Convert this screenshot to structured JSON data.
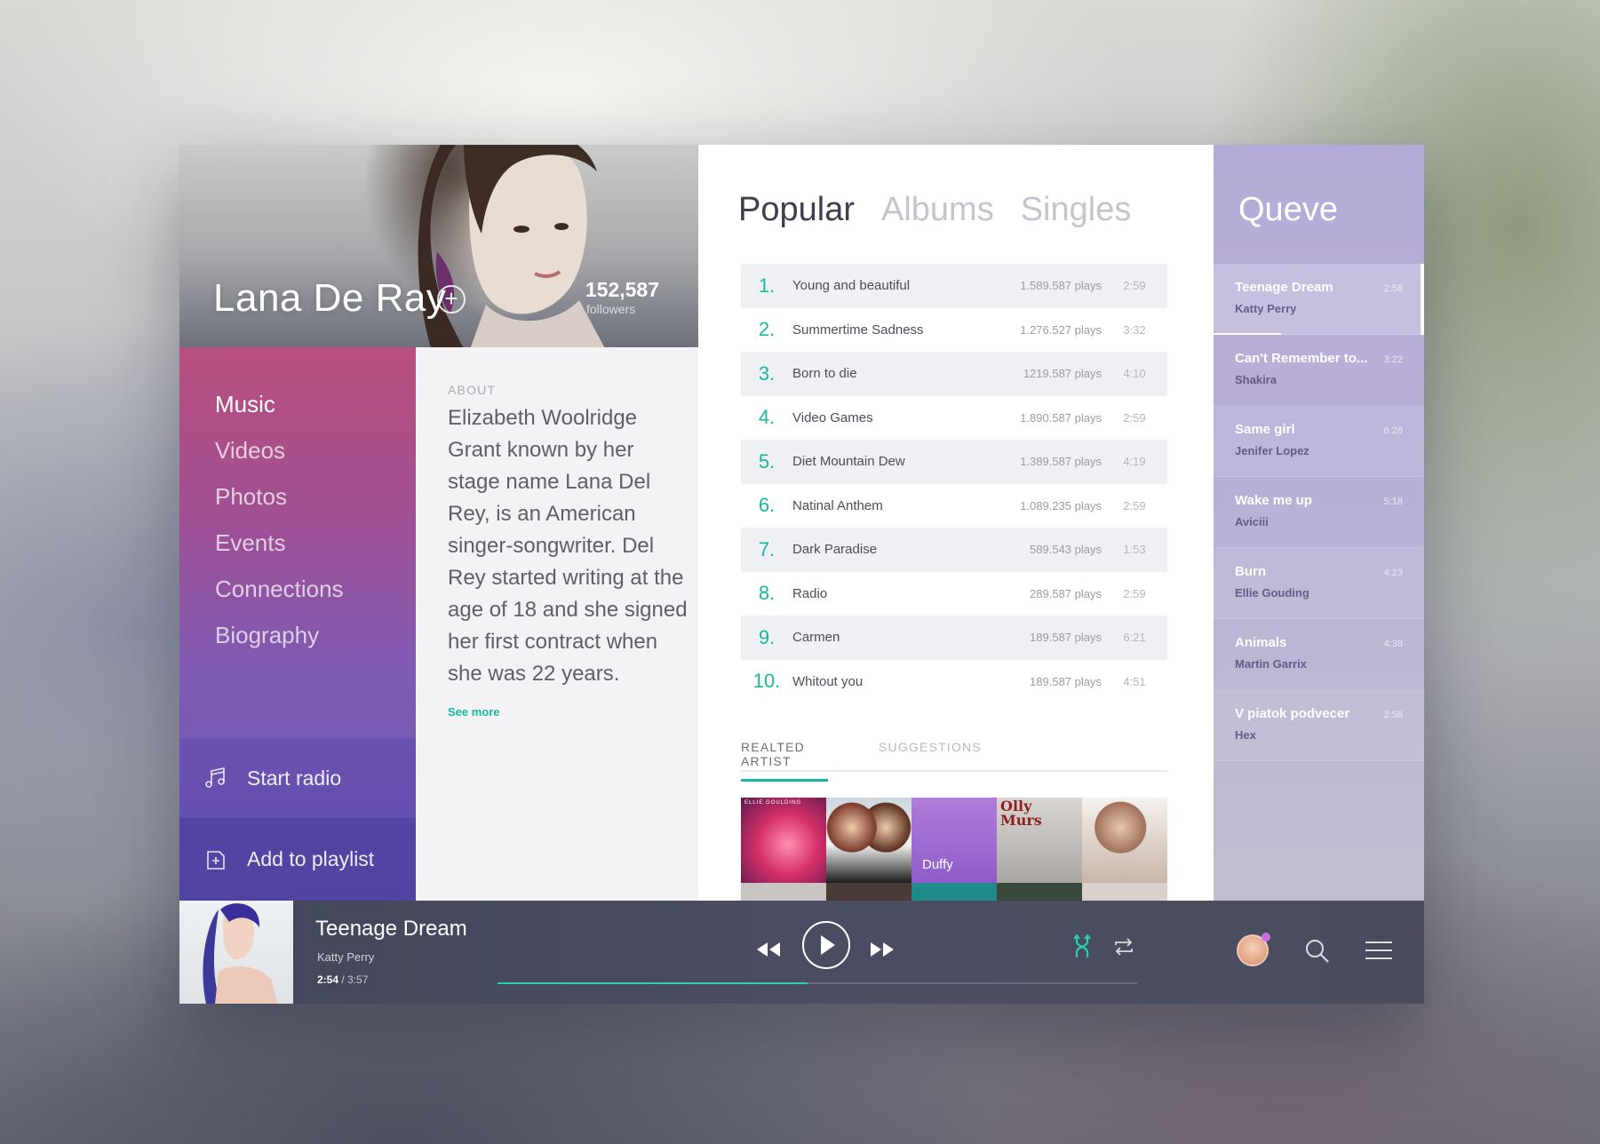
{
  "artist": {
    "name": "Lana De Ray",
    "followers_count": "152,587",
    "followers_label": "followers"
  },
  "nav": {
    "items": [
      {
        "label": "Music",
        "active": true
      },
      {
        "label": "Videos",
        "active": false
      },
      {
        "label": "Photos",
        "active": false
      },
      {
        "label": "Events",
        "active": false
      },
      {
        "label": "Connections",
        "active": false
      },
      {
        "label": "Biography",
        "active": false
      }
    ],
    "start_radio": "Start radio",
    "add_to_playlist": "Add to playlist"
  },
  "about": {
    "heading": "ABOUT",
    "text": "Elizabeth Woolridge Grant known by her stage name Lana Del Rey, is an American singer-songwriter. Del Rey started writing at the age of 18 and she signed her first contract when she was 22 years.",
    "see_more": "See more"
  },
  "tabs": [
    {
      "label": "Popular",
      "active": true
    },
    {
      "label": "Albums",
      "active": false
    },
    {
      "label": "Singles",
      "active": false
    }
  ],
  "tracks": [
    {
      "num": "1.",
      "title": "Young and beautiful",
      "plays": "1.589.587 plays",
      "duration": "2:59"
    },
    {
      "num": "2.",
      "title": "Summertime Sadness",
      "plays": "1.276.527 plays",
      "duration": "3:32"
    },
    {
      "num": "3.",
      "title": "Born to die",
      "plays": "1219.587 plays",
      "duration": "4:10"
    },
    {
      "num": "4.",
      "title": "Video Games",
      "plays": "1.890.587 plays",
      "duration": "2:59"
    },
    {
      "num": "5.",
      "title": "Diet Mountain Dew",
      "plays": "1.389.587 plays",
      "duration": "4:19"
    },
    {
      "num": "6.",
      "title": "Natinal Anthem",
      "plays": "1.089.235 plays",
      "duration": "2:59"
    },
    {
      "num": "7.",
      "title": "Dark Paradise",
      "plays": "589.543 plays",
      "duration": "1:53"
    },
    {
      "num": "8.",
      "title": "Radio",
      "plays": "289.587 plays",
      "duration": "2:59"
    },
    {
      "num": "9.",
      "title": "Carmen",
      "plays": "189.587 plays",
      "duration": "6:21"
    },
    {
      "num": "10.",
      "title": "Whitout you",
      "plays": "189.587 plays",
      "duration": "4:51"
    }
  ],
  "related": {
    "tab_active": "REALTED ARTIST",
    "tab_inactive": "SUGGESTIONS",
    "tiles": [
      {
        "label": "ELLIE GOULDING",
        "color": "#d6306a"
      },
      {
        "label": "",
        "color": "#cdd6dd"
      },
      {
        "label": "Duffy",
        "color": "#9f6fd0"
      },
      {
        "label": "Olly Murs",
        "color": "#c9c6c2"
      },
      {
        "label": "",
        "color": "#b88f7b"
      }
    ]
  },
  "queue": {
    "title": "Queve",
    "items": [
      {
        "title": "Teenage Dream",
        "artist": "Katty Perry",
        "duration": "2:58",
        "current": true
      },
      {
        "title": "Can't Remember to...",
        "artist": "Shakira",
        "duration": "3:22",
        "current": false
      },
      {
        "title": "Same girl",
        "artist": "Jenifer Lopez",
        "duration": "6:28",
        "current": false
      },
      {
        "title": "Wake me up",
        "artist": "Aviciii",
        "duration": "5:18",
        "current": false
      },
      {
        "title": "Burn",
        "artist": "Ellie Gouding",
        "duration": "4:23",
        "current": false
      },
      {
        "title": "Animals",
        "artist": "Martin Garrix",
        "duration": "4:38",
        "current": false
      },
      {
        "title": "V piatok podvecer",
        "artist": "Hex",
        "duration": "2:58",
        "current": false
      }
    ]
  },
  "player": {
    "title": "Teenage Dream",
    "artist": "Katty Perry",
    "time_current": "2:54",
    "time_total": "3:57",
    "progress": 0.485,
    "accent_color": "#2ad0b0"
  },
  "icons": {
    "rewind": "rewind-icon",
    "play": "play-icon",
    "forward": "fast-forward-icon",
    "shuffle": "shuffle-icon",
    "repeat": "repeat-icon",
    "search": "search-icon",
    "menu": "menu-icon"
  }
}
